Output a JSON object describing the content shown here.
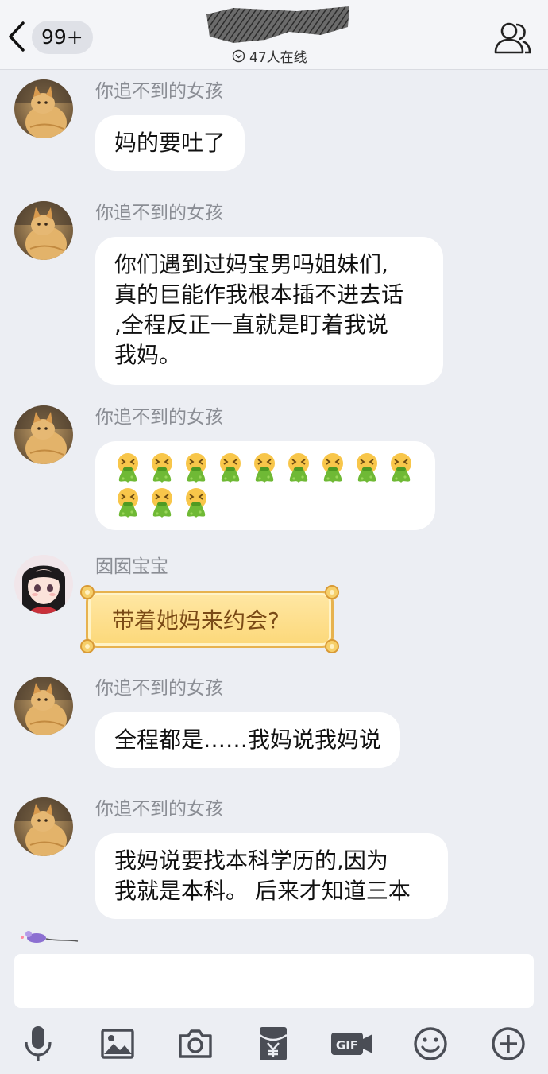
{
  "header": {
    "back_icon": "chevron-left-icon",
    "unread_badge": "99+",
    "online_text": "47人在线",
    "online_icon": "chevron-down-circle-icon",
    "group_icon": "group-members-icon"
  },
  "messages": [
    {
      "sender": "你追不到的女孩",
      "lines": [
        "妈的要吐了"
      ]
    },
    {
      "sender": "你追不到的女孩",
      "lines": [
        "你们遇到过妈宝男吗姐妹们,",
        "真的巨能作我根本插不进去话",
        ",全程反正一直就是盯着我说",
        "我妈。"
      ]
    },
    {
      "sender": "你追不到的女孩",
      "emoji": "vomiting-face-emoji",
      "emoji_count": 12
    },
    {
      "sender": "囡囡宝宝",
      "text": "带着她妈来约会?"
    },
    {
      "sender": "你追不到的女孩",
      "lines": [
        "全程都是……我妈说我妈说"
      ]
    },
    {
      "sender": "你追不到的女孩",
      "lines": [
        "我妈说要找本科学历的,因为",
        "我就是本科。 后来才知道三本"
      ]
    }
  ],
  "toolbar": {
    "icons": [
      "microphone-icon",
      "image-icon",
      "camera-icon",
      "red-packet-icon",
      "gif-icon",
      "emoji-icon",
      "plus-icon"
    ]
  },
  "colors": {
    "background": "#eceef3",
    "bubble": "#ffffff",
    "sender_text": "#8a8d94",
    "fancy_bubble": "#fcd879",
    "icon": "#4a4d55"
  }
}
